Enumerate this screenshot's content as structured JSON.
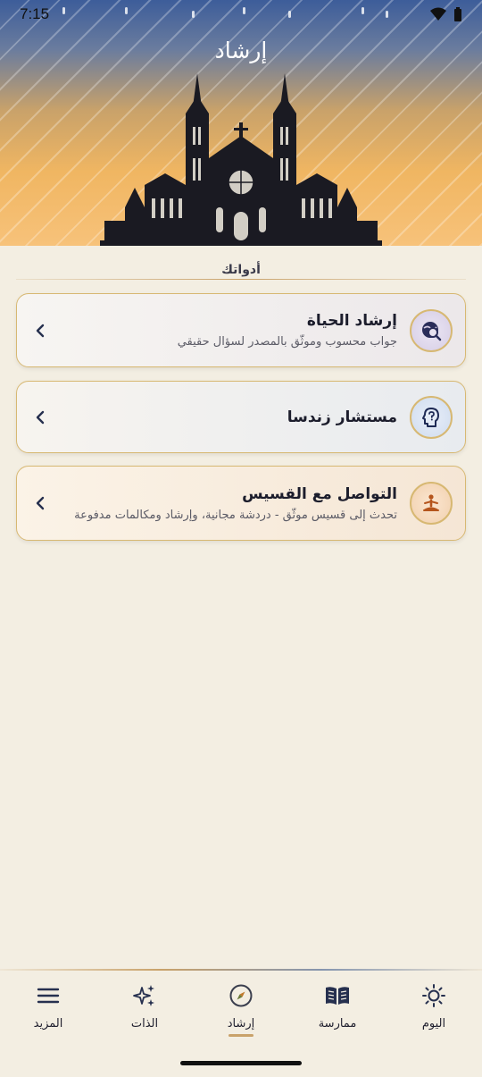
{
  "status_bar": {
    "time": "7:15"
  },
  "header": {
    "title": "إرشاد"
  },
  "section": {
    "heading": "أدواتك"
  },
  "cards": [
    {
      "title": "إرشاد الحياة",
      "subtitle": "جواب محسوب وموثّق بالمصدر لسؤال حقيقي",
      "icon": "search-globe-icon"
    },
    {
      "title": "مستشار زندسا",
      "subtitle": "",
      "icon": "head-question-icon"
    },
    {
      "title": "التواصل مع القسيس",
      "subtitle": "تحدث إلى قسيس موثّق - دردشة مجانية، وإرشاد ومكالمات مدفوعة",
      "icon": "meditating-person-icon"
    }
  ],
  "bottom_nav": {
    "items": [
      {
        "label": "اليوم",
        "icon": "sun-icon"
      },
      {
        "label": "ممارسة",
        "icon": "open-book-icon"
      },
      {
        "label": "إرشاد",
        "icon": "compass-icon",
        "active": true
      },
      {
        "label": "الذات",
        "icon": "sparkles-icon"
      },
      {
        "label": "المزيد",
        "icon": "menu-icon"
      }
    ]
  },
  "colors": {
    "background": "#f3eee2",
    "gold_accent": "#d7b872",
    "header_top": "#3d5d9a",
    "header_bottom": "#f7c27a"
  }
}
